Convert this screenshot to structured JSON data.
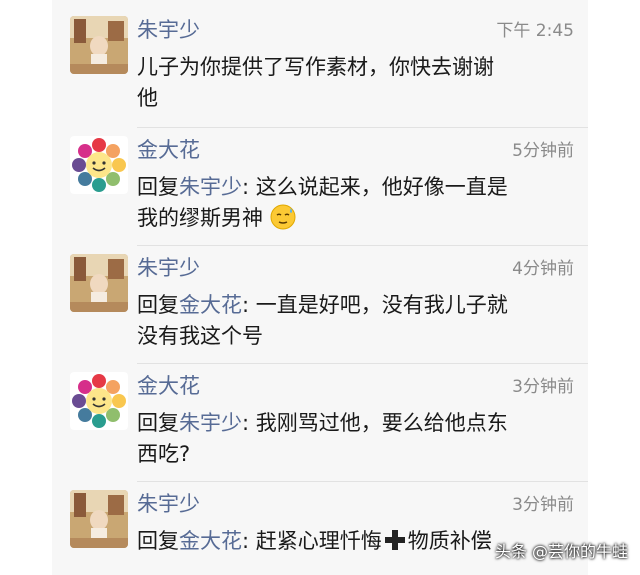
{
  "comments": [
    {
      "name": "朱宇少",
      "time": "下午 2:45",
      "avatar": "photo-avatar-icon",
      "lines": [
        {
          "prefix": "",
          "mention": "",
          "text": "儿子为你提供了写作素材，你快去谢谢"
        },
        {
          "prefix": "",
          "mention": "",
          "text": "他"
        }
      ]
    },
    {
      "name": "金大花",
      "time": "5分钟前",
      "avatar": "rainbow-flower-avatar-icon",
      "lines": [
        {
          "prefix": "回复",
          "mention": "朱宇少",
          "text": ": 这么说起来，他好像一直是"
        },
        {
          "prefix": "",
          "mention": "",
          "text": "我的缪斯男神"
        }
      ],
      "emoji": "relieved-sweat-emoji-icon"
    },
    {
      "name": "朱宇少",
      "time": "4分钟前",
      "avatar": "photo-avatar-icon",
      "lines": [
        {
          "prefix": "回复",
          "mention": "金大花",
          "text": ": 一直是好吧，没有我儿子就"
        },
        {
          "prefix": "",
          "mention": "",
          "text": "没有我这个号"
        }
      ]
    },
    {
      "name": "金大花",
      "time": "3分钟前",
      "avatar": "rainbow-flower-avatar-icon",
      "lines": [
        {
          "prefix": "回复",
          "mention": "朱宇少",
          "text": ": 我刚骂过他，要么给他点东"
        },
        {
          "prefix": "",
          "mention": "",
          "text": "西吃?"
        }
      ]
    },
    {
      "name": "朱宇少",
      "time": "3分钟前",
      "avatar": "photo-avatar-icon",
      "lines": [
        {
          "prefix": "回复",
          "mention": "金大花",
          "text": ": 赶紧心理忏悔",
          "after_plus": "物质补偿"
        }
      ],
      "plus_icon": "heavy-plus-icon"
    }
  ],
  "watermark": "头条 @芸你的牛蛙",
  "colors": {
    "name": "#576b95",
    "text": "#1a1a1a",
    "time": "#8a8a8a",
    "panel": "#f7f7f7"
  }
}
